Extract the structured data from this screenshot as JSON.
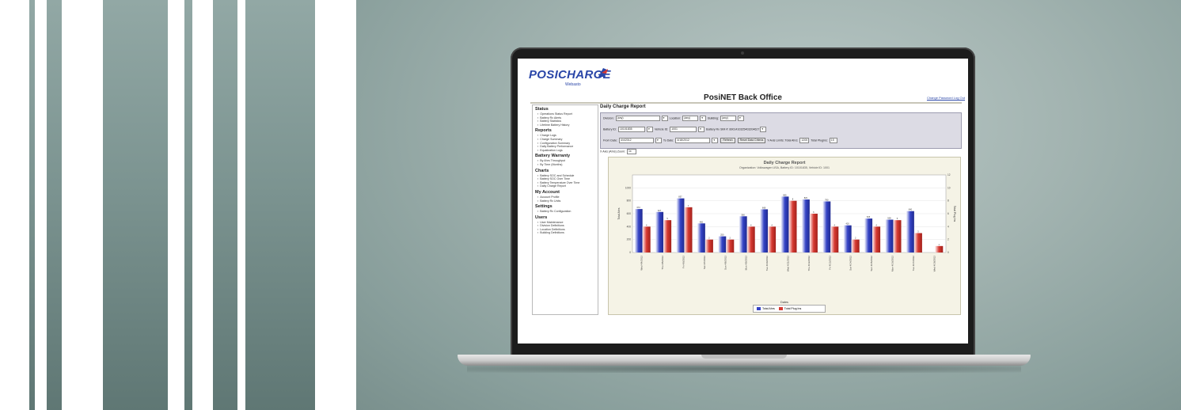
{
  "colors": {
    "bar_blue": "#3544c6",
    "bar_red": "#d63a32",
    "stripe": "#7f9693"
  },
  "logo": {
    "brand": "POSICHARGE",
    "sub": "Webasto",
    "mark_icon": "flag-arrow-icon"
  },
  "app": {
    "title": "PosiNET Back Office",
    "top_links": "Change Password Log Out"
  },
  "sidebar": {
    "sections": [
      {
        "title": "Status",
        "items": [
          "Operations Status Report",
          "Battery Rx Alerts",
          "Battery Statistics",
          "Lifetime Battery History"
        ]
      },
      {
        "title": "Reports",
        "items": [
          "Charge Logs",
          "Charge Summary",
          "Configuration Summary",
          "Daily Battery Performance",
          "Equalization Logs"
        ]
      },
      {
        "title": "Battery Warranty",
        "items": [
          "By Ahrs Throughput",
          "By Time (Months)"
        ]
      },
      {
        "title": "Charts",
        "items": [
          "Battery SOC and Schedule",
          "Battery SOC Over Time",
          "Battery Temperature Over Time",
          "Daily Charge Report"
        ]
      },
      {
        "title": "My Account",
        "items": [
          "Account Profile",
          "Battery Rx Units"
        ]
      },
      {
        "title": "Settings",
        "items": [
          "Battery Rx Configuration"
        ]
      },
      {
        "title": "Users",
        "items": [
          "User Maintenance",
          "Division Definitions",
          "Location Definitions",
          "Building Definitions"
        ]
      }
    ]
  },
  "report": {
    "header": "Daily Charge Report",
    "division_label": "Division:",
    "division_value": "(any)",
    "location_label": "Location:",
    "location_value": "(any)",
    "building_label": "Building:",
    "building_value": "(any)",
    "battery_id_label": "Battery ID:",
    "battery_id_value": "10101835",
    "vehicle_id_label": "Vehicle ID:",
    "vehicle_id_value": "1001",
    "sim_label": "Battery Rx SIM #:",
    "sim_value": "8901410325403204627",
    "from_label": "From Date:",
    "from_value": "4/4/2012",
    "to_label": "To Date:",
    "to_value": "4/18/2012",
    "refresh_label": "Refresh",
    "reset_label": "Reset Data Criteria",
    "ylimits_label": "Y-Axis Limits: Total Ahrs:",
    "ylimits_ahrs": "1200",
    "plugins_label": "Total Plugins:",
    "plugins_value": "15",
    "zoom_label": "X Axis (Ahrs) Zoom:",
    "zoom_value": "1x"
  },
  "chart_data": {
    "type": "bar",
    "title": "Daily Charge Report",
    "subtitle": "Organization: Volkswagen USA, Battery ID: 10101835, Vehicle ID: 1001",
    "xlabel": "Dates",
    "ylabel": "Total Ahrs",
    "y2label": "Total Plug Ins",
    "ylim": [
      0,
      1200
    ],
    "y2lim": [
      0,
      12
    ],
    "categories": [
      "Wed 4/4/2012",
      "Thu 4/5/2012",
      "Fri 4/6/2012",
      "Sat 4/7/2012",
      "Sun 4/8/2012",
      "Mon 4/9/2012",
      "Tue 4/10/2012",
      "Wed 4/11/2012",
      "Thu 4/12/2012",
      "Fri 4/13/2012",
      "Sat 4/14/2012",
      "Sun 4/15/2012",
      "Mon 4/16/2012",
      "Tue 4/17/2012",
      "Wed 4/18/2012"
    ],
    "series": [
      {
        "name": "Total Ahrs",
        "axis": "left",
        "values": [
          672,
          627,
          837,
          450,
          250,
          560,
          668,
          865,
          820,
          790,
          420,
          525,
          508,
          640,
          0
        ]
      },
      {
        "name": "Total Plug Ins",
        "axis": "right",
        "values": [
          4,
          5,
          7,
          2,
          2,
          4,
          4,
          8,
          6,
          4,
          2,
          4,
          5,
          3,
          1
        ]
      }
    ],
    "y_ticks": [
      "0",
      "200",
      "400",
      "600",
      "800",
      "1000"
    ],
    "y2_ticks": [
      "0",
      "2",
      "4",
      "6",
      "8",
      "10",
      "12"
    ],
    "grid": true,
    "legend": "bottom"
  }
}
